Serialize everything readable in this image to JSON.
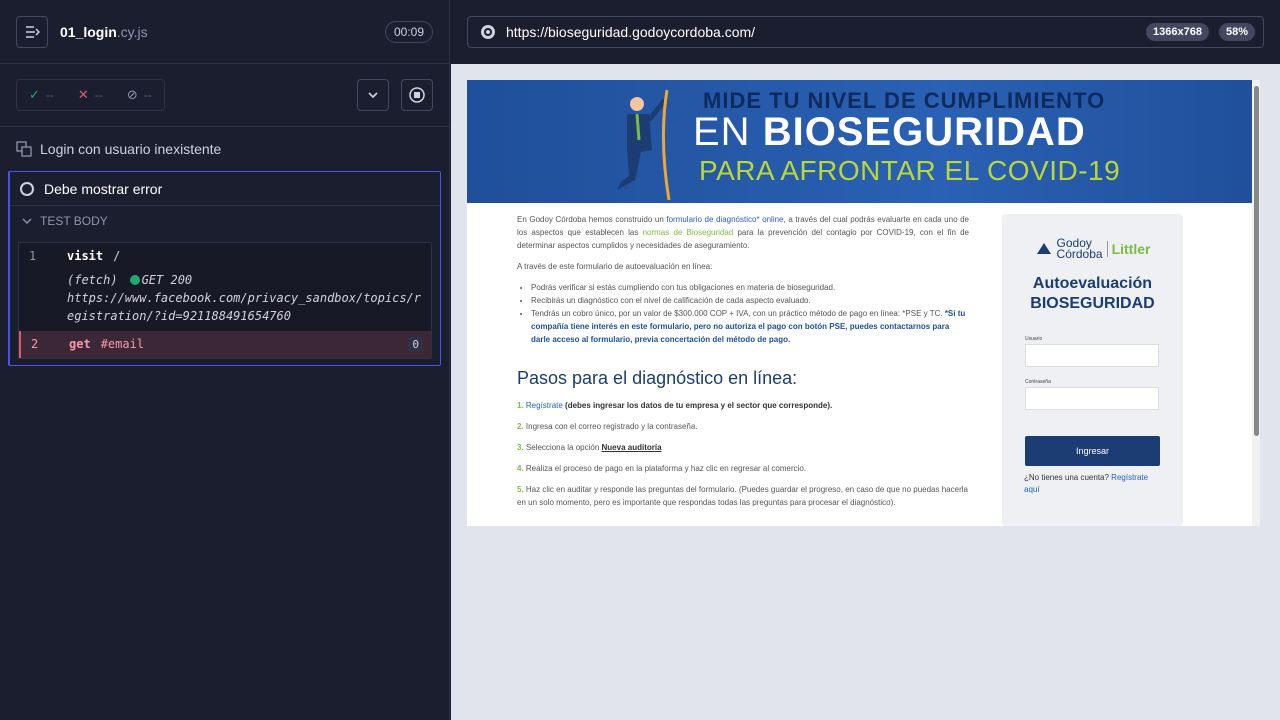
{
  "runner": {
    "spec_name": "01_login",
    "spec_ext": ".cy.js",
    "timer": "00:09",
    "stats": {
      "passed": "--",
      "failed": "--",
      "pending": "--"
    },
    "suite_title": "Login con usuario inexistente",
    "test_title": "Debe mostrar error",
    "body_label": "TEST BODY",
    "commands": [
      {
        "num": "1",
        "name": "visit",
        "arg": "/"
      },
      {
        "num": "2",
        "name": "get",
        "arg": "#email",
        "count": "0"
      }
    ],
    "fetch": {
      "label": "(fetch)",
      "method_status": "GET 200",
      "url": "https://www.facebook.com/privacy_sandbox/topics/registration/?id=921188491654760"
    }
  },
  "browser": {
    "url": "https://bioseguridad.godoycordoba.com/",
    "viewport": "1366x768",
    "zoom": "58%"
  },
  "site": {
    "banner": {
      "line1": "MIDE TU NIVEL DE CUMPLIMIENTO",
      "line2_prefix": "EN ",
      "line2_bold": "BIOSEGURIDAD",
      "line3": "PARA AFRONTAR EL COVID-19"
    },
    "intro_a": "En Godoy Córdoba hemos construido un ",
    "intro_link": "formulario de diagnóstico* online",
    "intro_b": ", a través del cual podrás evaluarte en cada uno de los aspectos que establecen las ",
    "intro_link2": "normas de Bioseguridad",
    "intro_c": " para la prevención del contagio por COVID-19, con el fin de determinar aspectos cumplidos y necesidades de aseguramiento.",
    "intro2": "A través de este formulario de autoevaluación en línea:",
    "bullets": [
      "Podrás verificar si estás cumpliendo con tus obligaciones en materia de bioseguridad.",
      "Recibirás un diagnóstico con el nivel de calificación de cada aspecto evaluado."
    ],
    "bullet3_a": "Tendrás un cobro único, por un valor de $300.000 COP + IVA, con un práctico método de pago en línea: *PSE y TC. ",
    "bullet3_b": "*Si tu compañía tiene interés en este formulario, pero no autoriza el pago con botón PSE, puedes contactarnos para darle acceso al formulario, previa concertación del método de pago.",
    "steps_title": "Pasos para el diagnóstico en línea:",
    "steps": [
      {
        "n": "1.",
        "text": "Regístrate ",
        "bold": "(debes ingresar los datos de tu empresa y el sector que corresponde)."
      },
      {
        "n": "2.",
        "text": "Ingresa con el correo registrado y la contraseña.",
        "bold": ""
      },
      {
        "n": "3.",
        "text": "Selecciona la opción ",
        "bold": "Nueva auditoría"
      },
      {
        "n": "4.",
        "text": "Realiza el proceso de pago en la plataforma y haz clic en regresar al comercio.",
        "bold": ""
      },
      {
        "n": "5.",
        "text": "Haz clic en auditar y responde las preguntas del formulario. (Puedes guardar el progreso, en caso de que no puedas hacerla en un solo momento, pero es importante que respondas todas las preguntas para procesar el diagnóstico).",
        "bold": ""
      }
    ],
    "login": {
      "logo_a": "Godoy",
      "logo_b": "Córdoba",
      "logo_partner": "Littler",
      "title1": "Autoevaluación",
      "title2": "BIOSEGURIDAD",
      "user_label": "Usuario",
      "pass_label": "Contraseña",
      "button": "Ingresar",
      "register_q": "¿No tienes una cuenta? ",
      "register_link": "Regístrate aquí"
    }
  }
}
